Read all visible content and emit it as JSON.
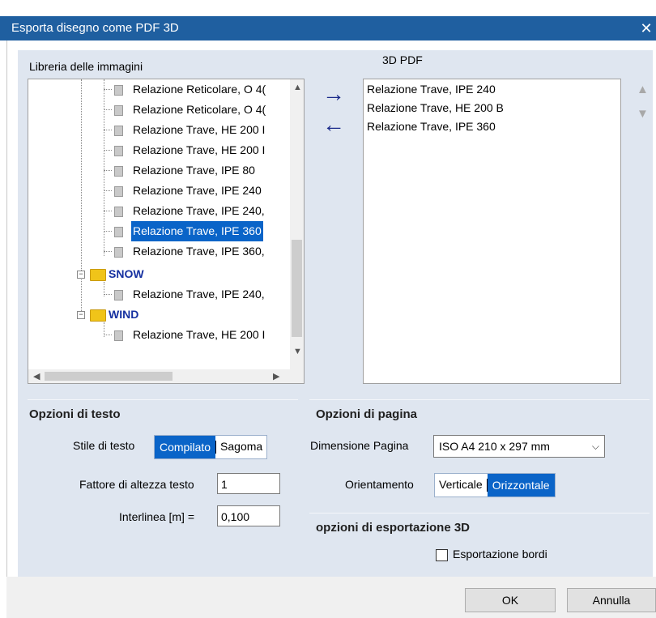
{
  "window": {
    "title": "Esporta disegno come PDF 3D",
    "close_glyph": "✕"
  },
  "library": {
    "label": "Libreria delle immagini",
    "items": [
      "Relazione Reticolare, O 4(",
      "Relazione Reticolare, O 4(",
      "Relazione Trave, HE  200 I",
      "Relazione Trave, HE  200 I",
      "Relazione Trave, IPE  80",
      "Relazione Trave, IPE 240",
      "Relazione Trave, IPE 240,",
      "Relazione Trave, IPE 360",
      "Relazione Trave, IPE 360,"
    ],
    "selected_index": 7,
    "folders": [
      {
        "name": "SNOW",
        "items": [
          "Relazione Trave, IPE 240,"
        ]
      },
      {
        "name": "WIND",
        "items": [
          "Relazione Trave, HE  200 I"
        ]
      }
    ]
  },
  "pdf": {
    "label": "3D PDF",
    "items": [
      "Relazione Trave, IPE 240",
      "Relazione Trave, HE  200 B",
      "Relazione Trave, IPE 360"
    ]
  },
  "icons": {
    "add": "arrow-right-icon",
    "remove": "arrow-left-icon",
    "move_up": "arrow-up-icon",
    "move_down": "arrow-down-icon"
  },
  "text_options": {
    "title": "Opzioni di testo",
    "style_label": "Stile di testo",
    "style_options": [
      "Compilato",
      "Sagoma"
    ],
    "style_selected": "Compilato",
    "height_factor_label": "Fattore di altezza testo",
    "height_factor_value": "1",
    "line_spacing_label": "Interlinea [m] =",
    "line_spacing_value": "0,100"
  },
  "page_options": {
    "title": "Opzioni di pagina",
    "size_label": "Dimensione Pagina",
    "size_value": "ISO A4 210 x 297 mm",
    "orientation_label": "Orientamento",
    "orientation_options": [
      "Verticale",
      "Orizzontale"
    ],
    "orientation_selected": "Orizzontale"
  },
  "export_3d": {
    "title": "opzioni di esportazione 3D",
    "border_export_label": "Esportazione bordi",
    "border_export_checked": false
  },
  "buttons": {
    "ok": "OK",
    "cancel": "Annulla"
  },
  "colors": {
    "titlebar": "#1f5fa0",
    "panel": "#dfe6f0",
    "selection": "#0a64c8",
    "folder_text": "#1530a0"
  }
}
